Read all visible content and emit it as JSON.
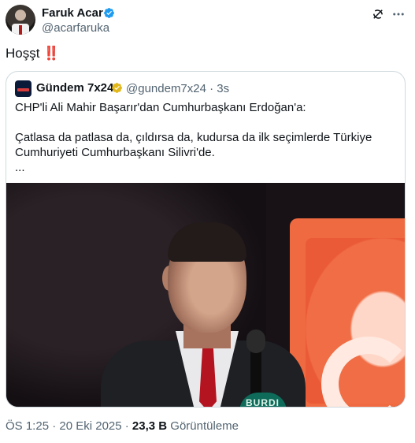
{
  "author": {
    "display_name": "Faruk Acar",
    "handle": "@acarfaruka",
    "verified_color": "#1d9bf0"
  },
  "tweet": {
    "text": "Hoşşt",
    "emoji": "‼️"
  },
  "quoted": {
    "display_name": "Gündem 7x24",
    "handle_time": "@gundem7x24 · 3s",
    "badge_color": "#e2b719",
    "body": "CHP'li Ali Mahir Başarır'dan Cumhurbaşkanı Erdoğan'a:\n\nÇatlasa da patlasa da, çıldırsa da, kudursa da ilk seçimlerde Türkiye Cumhuriyeti Cumhurbaşkanı Silivri'de.\n...",
    "video_podium_text": "BURDI"
  },
  "meta": {
    "time_date": "ÖS 1:25 · 20 Eki 2025 · ",
    "views_count": "23,3 B",
    "views_label": " Görüntüleme"
  },
  "icons": {
    "grok": "grok-icon",
    "more": "more-options-icon"
  }
}
